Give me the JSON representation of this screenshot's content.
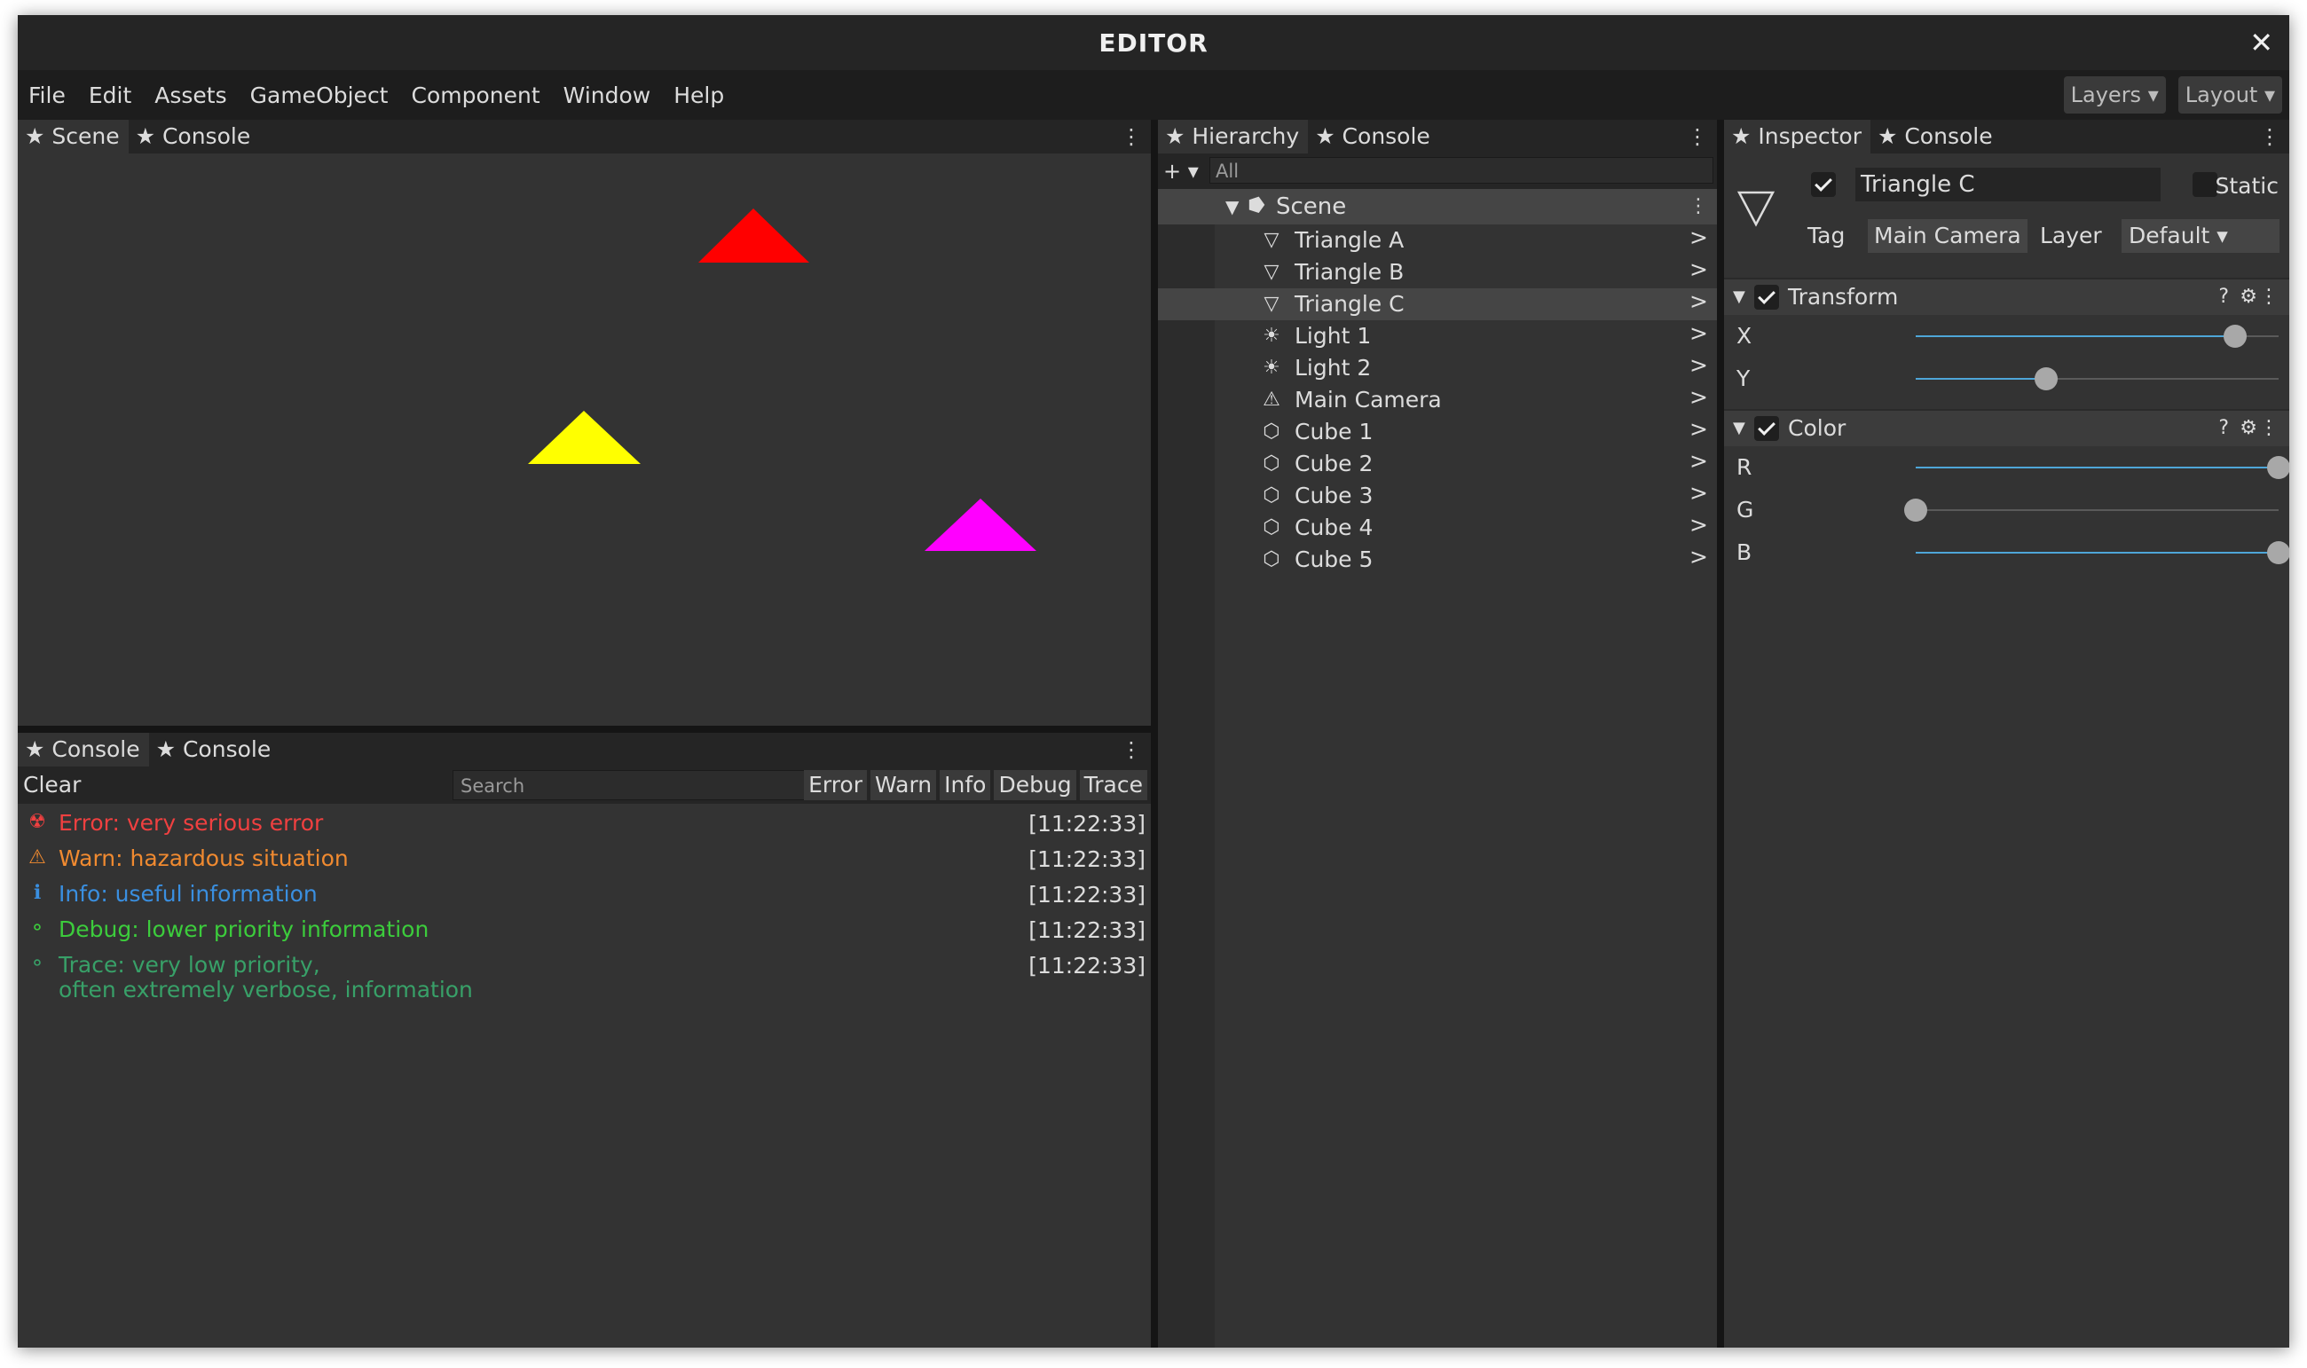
{
  "window": {
    "title": "EDITOR",
    "close_glyph": "✕"
  },
  "menu": {
    "items": [
      "File",
      "Edit",
      "Assets",
      "GameObject",
      "Component",
      "Window",
      "Help"
    ],
    "layers_label": "Layers ▾",
    "layout_label": "Layout ▾"
  },
  "scene_panel": {
    "tabs": [
      "★ Scene",
      "★ Console"
    ],
    "more_glyph": "⋮",
    "objects": [
      {
        "name": "Triangle A",
        "color": "#ff0000"
      },
      {
        "name": "Triangle B",
        "color": "#ffff00"
      },
      {
        "name": "Triangle C",
        "color": "#ff00ff"
      }
    ]
  },
  "console_panel": {
    "tabs": [
      "★ Console",
      "★ Console"
    ],
    "more_glyph": "⋮",
    "clear_label": "Clear",
    "search_placeholder": "Search",
    "filters": [
      "Error",
      "Warn",
      "Info",
      "Debug",
      "Trace"
    ],
    "logs": [
      {
        "icon": "☢",
        "icon_name": "radiation-icon",
        "line1": "Error: very serious error",
        "line2": "",
        "time": "[11:22:33]",
        "color": "#f04040"
      },
      {
        "icon": "⚠",
        "icon_name": "warning-icon",
        "line1": "Warn: hazardous situation",
        "line2": "",
        "time": "[11:22:33]",
        "color": "#f08a30"
      },
      {
        "icon": "ℹ",
        "icon_name": "info-icon",
        "line1": "Info: useful information",
        "line2": "",
        "time": "[11:22:33]",
        "color": "#3a8fe0"
      },
      {
        "icon": "⚬",
        "icon_name": "debug-icon",
        "line1": "Debug: lower priority information",
        "line2": "",
        "time": "[11:22:33]",
        "color": "#3ccc3c"
      },
      {
        "icon": "⚬",
        "icon_name": "trace-icon",
        "line1": "Trace: very low priority,",
        "line2": "often extremely verbose, information",
        "time": "[11:22:33]",
        "color": "#38a068"
      }
    ]
  },
  "hierarchy_panel": {
    "tabs": [
      "★ Hierarchy",
      "★ Console"
    ],
    "more_glyph": "⋮",
    "add_label": "+ ▾",
    "filter_placeholder": "All",
    "scene": {
      "arrow": "▼",
      "icon": "⭓",
      "label": "Scene",
      "more": "⋮"
    },
    "items": [
      {
        "icon": "▽",
        "icon_name": "triangle-icon",
        "label": "Triangle A",
        "selected": false
      },
      {
        "icon": "▽",
        "icon_name": "triangle-icon",
        "label": "Triangle B",
        "selected": false
      },
      {
        "icon": "▽",
        "icon_name": "triangle-icon",
        "label": "Triangle C",
        "selected": true
      },
      {
        "icon": "☀",
        "icon_name": "light-icon",
        "label": "Light 1",
        "selected": false
      },
      {
        "icon": "☀",
        "icon_name": "light-icon",
        "label": "Light 2",
        "selected": false
      },
      {
        "icon": "⚠",
        "icon_name": "camera-icon",
        "label": "Main Camera",
        "selected": false
      },
      {
        "icon": "⬡",
        "icon_name": "cube-icon",
        "label": "Cube 1",
        "selected": false
      },
      {
        "icon": "⬡",
        "icon_name": "cube-icon",
        "label": "Cube 2",
        "selected": false
      },
      {
        "icon": "⬡",
        "icon_name": "cube-icon",
        "label": "Cube 3",
        "selected": false
      },
      {
        "icon": "⬡",
        "icon_name": "cube-icon",
        "label": "Cube 4",
        "selected": false
      },
      {
        "icon": "⬡",
        "icon_name": "cube-icon",
        "label": "Cube 5",
        "selected": false
      }
    ],
    "row_arrow": ">"
  },
  "inspector_panel": {
    "tabs": [
      "★ Inspector",
      "★ Console"
    ],
    "more_glyph": "⋮",
    "object_name": "Triangle C",
    "active": true,
    "static_label": "Static",
    "static_checked": false,
    "tag_label": "Tag",
    "tag_value": "Main Camera",
    "layer_label": "Layer",
    "layer_value": "Default ▾",
    "components": [
      {
        "name": "Transform",
        "enabled": true,
        "arrow": "▼",
        "help": "?",
        "gear": "⚙",
        "more": "⋮",
        "props": [
          {
            "label": "X",
            "value": 0.88
          },
          {
            "label": "Y",
            "value": 0.36
          }
        ]
      },
      {
        "name": "Color",
        "enabled": true,
        "arrow": "▼",
        "help": "?",
        "gear": "⚙",
        "more": "⋮",
        "props": [
          {
            "label": "R",
            "value": 1.0
          },
          {
            "label": "G",
            "value": 0.0
          },
          {
            "label": "B",
            "value": 1.0
          }
        ]
      }
    ]
  },
  "colors": {
    "slider_fill": "#4ea6d8",
    "selection": "#454545"
  }
}
